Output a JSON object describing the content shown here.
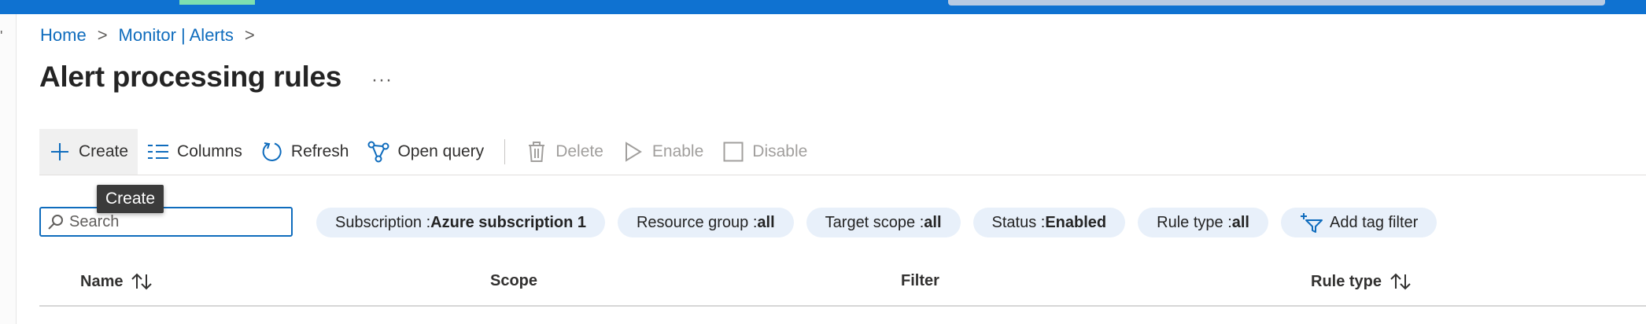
{
  "breadcrumb": {
    "home": "Home",
    "parent": "Monitor | Alerts",
    "separator": ">"
  },
  "page": {
    "title": "Alert processing rules",
    "more_label": "···"
  },
  "toolbar": {
    "create": "Create",
    "columns": "Columns",
    "refresh": "Refresh",
    "open_query": "Open query",
    "delete": "Delete",
    "enable": "Enable",
    "disable": "Disable"
  },
  "tooltip": {
    "text": "Create"
  },
  "search": {
    "placeholder": "Search",
    "value": ""
  },
  "filters": [
    {
      "key": "Subscription : ",
      "value": "Azure subscription 1"
    },
    {
      "key": "Resource group : ",
      "value": "all"
    },
    {
      "key": "Target scope : ",
      "value": "all"
    },
    {
      "key": "Status : ",
      "value": "Enabled"
    },
    {
      "key": "Rule type : ",
      "value": "all"
    }
  ],
  "add_tag_filter": "Add tag filter",
  "table": {
    "columns": [
      "Name",
      "Scope",
      "Filter",
      "Rule type"
    ]
  },
  "colors": {
    "topbar": "#0f72d1",
    "link": "#0f6cbd",
    "pill_bg": "#e8f0fa",
    "disabled_text": "#a19f9d"
  },
  "icons": {
    "create": "plus-icon",
    "columns": "columns-icon",
    "refresh": "refresh-icon",
    "open_query": "query-icon",
    "delete": "trash-icon",
    "enable": "play-icon",
    "disable": "checkbox-icon",
    "search": "search-icon",
    "add_tag_filter": "add-filter-icon",
    "sort": "sort-icon"
  }
}
